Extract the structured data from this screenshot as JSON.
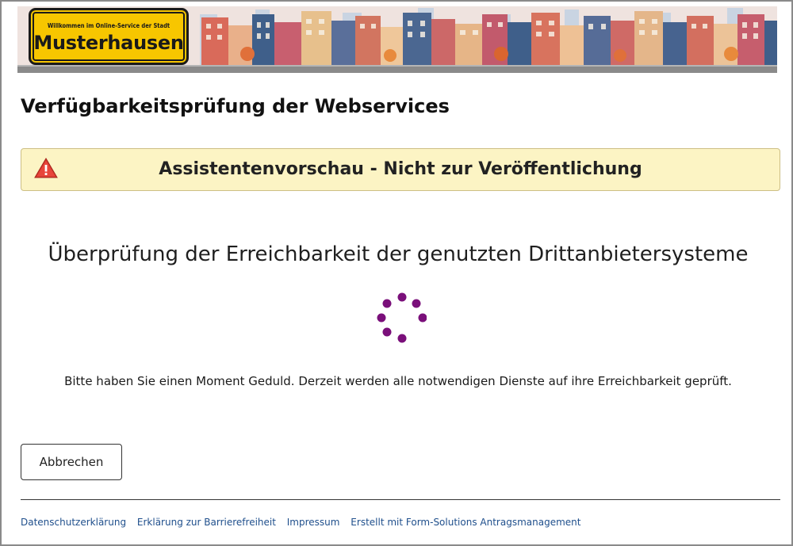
{
  "header": {
    "sign_subtitle": "Willkommen im Online-Service der Stadt",
    "sign_title": "Musterhausen"
  },
  "page": {
    "title": "Verfügbarkeitsprüfung der Webservices"
  },
  "preview_alert": {
    "text": "Assistentenvorschau - Nicht zur Veröffentlichung",
    "icon": "warning-triangle-icon"
  },
  "check": {
    "heading": "Überprüfung der Erreichbarkeit der genutzten Drittanbietersysteme",
    "wait_text": "Bitte haben Sie einen Moment Geduld. Derzeit werden alle notwendigen Dienste auf ihre Erreichbarkeit geprüft.",
    "spinner_color": "#7a0f7a"
  },
  "actions": {
    "cancel_label": "Abbrechen"
  },
  "footer": {
    "links": [
      "Datenschutzerklärung",
      "Erklärung zur Barrierefreiheit",
      "Impressum",
      "Erstellt mit Form-Solutions Antragsmanagement"
    ]
  },
  "colors": {
    "alert_background": "#fcf4c4",
    "sign_yellow": "#f7c600",
    "link": "#1f4f8c"
  }
}
